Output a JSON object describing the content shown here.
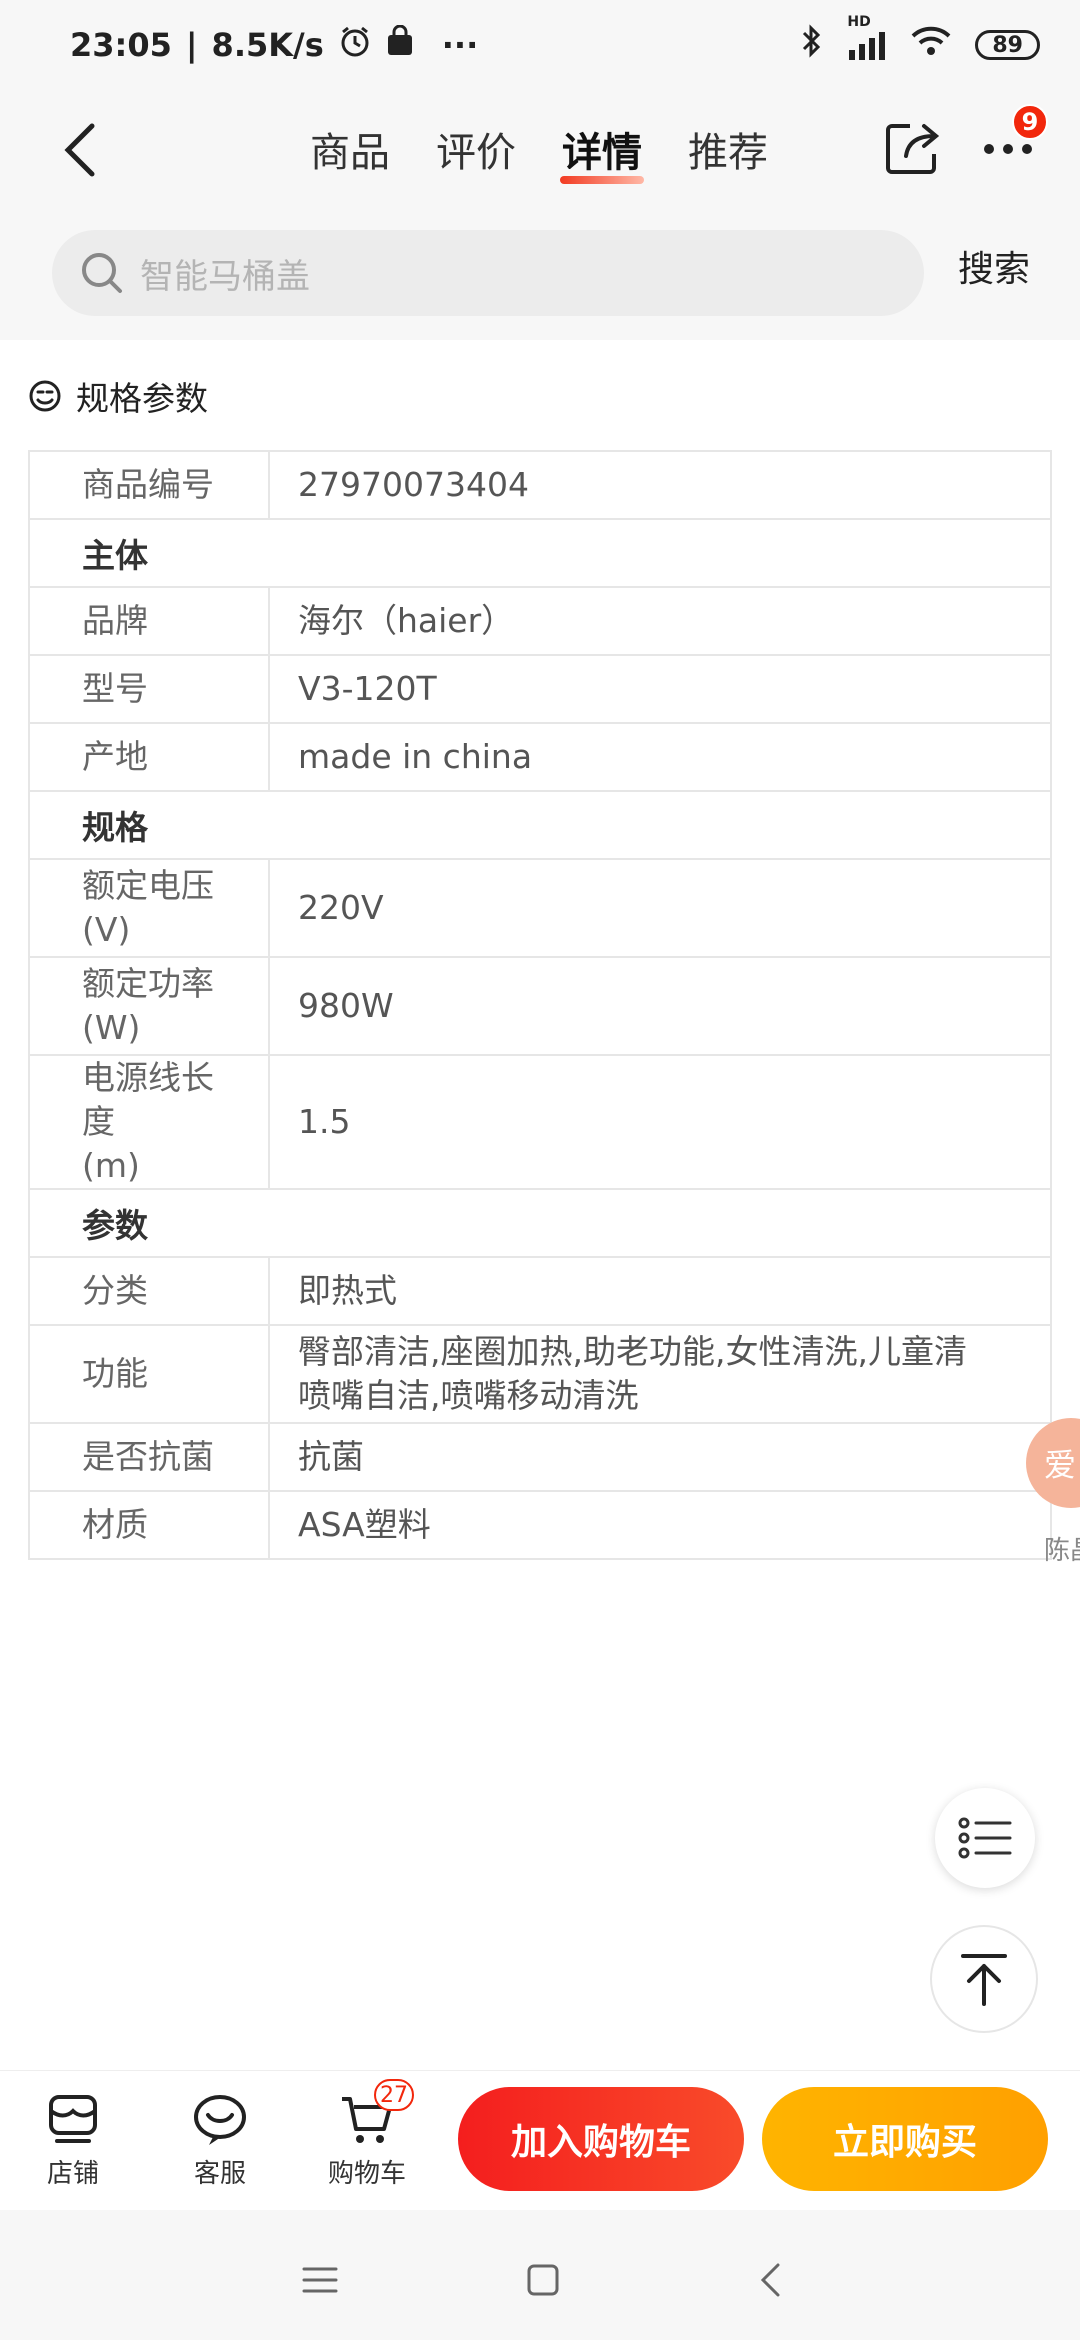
{
  "status_bar": {
    "time": "23:05",
    "network_speed": "8.5K/s",
    "more": "···",
    "signal_label": "HD",
    "battery": "89"
  },
  "header": {
    "tabs": [
      {
        "label": "商品",
        "active": false
      },
      {
        "label": "评价",
        "active": false
      },
      {
        "label": "详情",
        "active": true
      },
      {
        "label": "推荐",
        "active": false
      }
    ],
    "more_badge": "9"
  },
  "search": {
    "placeholder": "智能马桶盖",
    "button_label": "搜索"
  },
  "specs": {
    "title": "规格参数",
    "rows": [
      {
        "type": "kv",
        "key": "商品编号",
        "value": "27970073404"
      },
      {
        "type": "group",
        "key": "主体"
      },
      {
        "type": "kv",
        "key": "品牌",
        "value": "海尔（haier）"
      },
      {
        "type": "kv",
        "key": "型号",
        "value": "V3-120T"
      },
      {
        "type": "kv",
        "key": "产地",
        "value": "made in china"
      },
      {
        "type": "group",
        "key": "规格"
      },
      {
        "type": "kv",
        "key": "额定电压\n(V)",
        "value": "220V"
      },
      {
        "type": "kv",
        "key": "额定功率\n(W)",
        "value": "980W"
      },
      {
        "type": "kv",
        "key": "电源线长\n度\n(m)",
        "value": "1.5"
      },
      {
        "type": "group",
        "key": "参数"
      },
      {
        "type": "kv",
        "key": "分类",
        "value": "即热式"
      },
      {
        "type": "kv",
        "key": "功能",
        "value": "臀部清洁,座圈加热,助老功能,女性清洗,儿童清\n喷嘴自洁,喷嘴移动清洗"
      },
      {
        "type": "kv",
        "key": "是否抗菌",
        "value": "抗菌"
      },
      {
        "type": "kv",
        "key": "材质",
        "value": "ASA塑料"
      }
    ]
  },
  "floating": {
    "avatar_text": "爱",
    "avatar_name": "陈晶"
  },
  "bottom_bar": {
    "store_label": "店铺",
    "service_label": "客服",
    "cart_label": "购物车",
    "cart_badge": "27",
    "add_to_cart": "加入购物车",
    "buy_now": "立即购买"
  },
  "colors": {
    "accent_red": "#f2270c",
    "buy_orange": "#ffad00"
  }
}
